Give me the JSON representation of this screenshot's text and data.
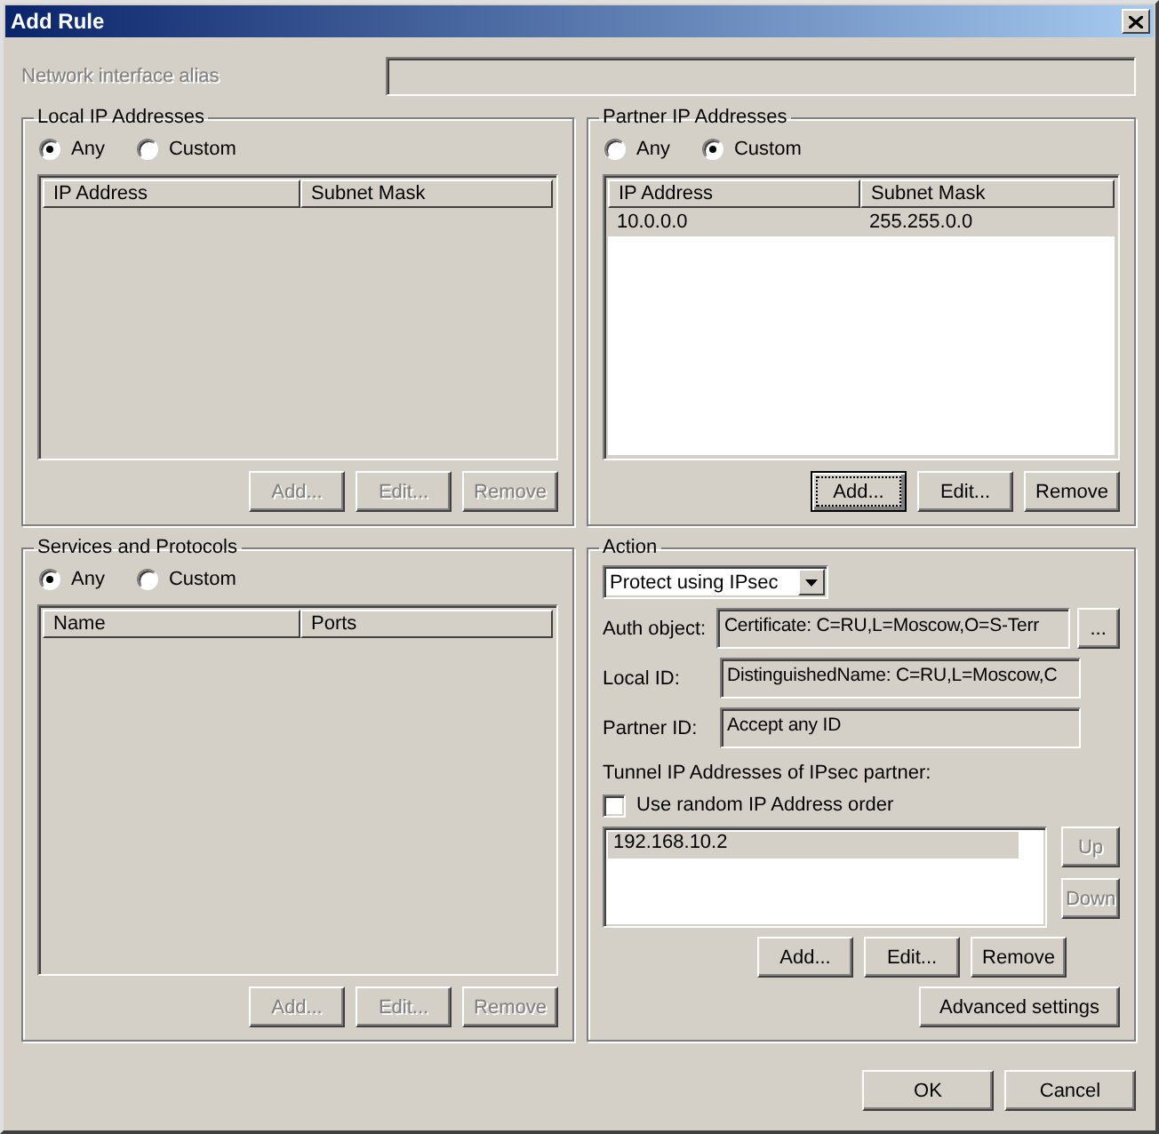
{
  "window": {
    "title": "Add Rule"
  },
  "alias": {
    "label": "Network interface alias",
    "disabled": true
  },
  "local_ip": {
    "title": "Local IP Addresses",
    "radios": [
      {
        "label": "Any",
        "selected": true
      },
      {
        "label": "Custom",
        "selected": false
      }
    ],
    "columns": [
      "IP Address",
      "Subnet Mask"
    ],
    "buttons": [
      {
        "label": "Add...",
        "disabled": true,
        "focused": false
      },
      {
        "label": "Edit...",
        "disabled": true,
        "focused": false
      },
      {
        "label": "Remove",
        "disabled": true,
        "focused": false
      }
    ]
  },
  "partner_ip": {
    "title": "Partner IP Addresses",
    "radios": [
      {
        "label": "Any",
        "selected": false
      },
      {
        "label": "Custom",
        "selected": true
      }
    ],
    "columns": [
      "IP Address",
      "Subnet Mask"
    ],
    "rows": [
      {
        "cells": [
          "10.0.0.0",
          "255.255.0.0"
        ],
        "selected": true
      }
    ],
    "buttons": [
      {
        "label": "Add...",
        "disabled": false,
        "focused": true
      },
      {
        "label": "Edit...",
        "disabled": false,
        "focused": false
      },
      {
        "label": "Remove",
        "disabled": false,
        "focused": false
      }
    ]
  },
  "services": {
    "title": "Services and Protocols",
    "radios": [
      {
        "label": "Any",
        "selected": true
      },
      {
        "label": "Custom",
        "selected": false
      }
    ],
    "columns": [
      "Name",
      "Ports"
    ],
    "buttons": [
      {
        "label": "Add...",
        "disabled": true,
        "focused": false
      },
      {
        "label": "Edit...",
        "disabled": true,
        "focused": false
      },
      {
        "label": "Remove",
        "disabled": true,
        "focused": false
      }
    ]
  },
  "action": {
    "title": "Action",
    "mode": "Protect using IPsec",
    "fields": [
      {
        "label": "Auth object:",
        "value": "Certificate: C=RU,L=Moscow,O=S-Terr",
        "browse": "..."
      },
      {
        "label": "Local ID:",
        "value": "DistinguishedName: C=RU,L=Moscow,C"
      },
      {
        "label": "Partner ID:",
        "value": "Accept any ID"
      }
    ],
    "tunnel_label": "Tunnel IP Addresses of IPsec partner:",
    "random_order": {
      "label": "Use random IP Address order",
      "checked": false
    },
    "tunnel_list": [
      {
        "text": "192.168.10.2",
        "selected": true
      }
    ],
    "side_buttons": [
      {
        "label": "Up",
        "disabled": true
      },
      {
        "label": "Down",
        "disabled": true
      }
    ],
    "buttons": [
      {
        "label": "Add...",
        "disabled": false,
        "focused": false
      },
      {
        "label": "Edit...",
        "disabled": false,
        "focused": false
      },
      {
        "label": "Remove",
        "disabled": false,
        "focused": false
      }
    ],
    "advanced": "Advanced settings"
  },
  "footer": [
    {
      "label": "OK"
    },
    {
      "label": "Cancel"
    }
  ]
}
